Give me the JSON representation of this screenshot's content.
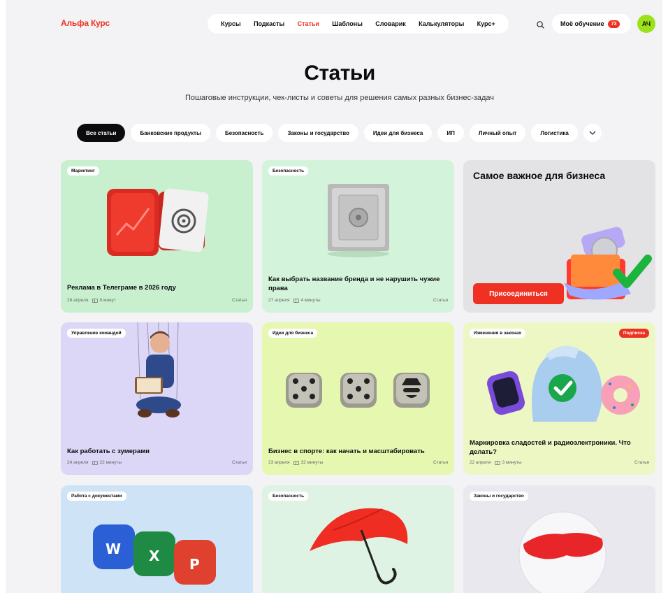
{
  "header": {
    "logo": "Альфа Курс",
    "nav": [
      "Курсы",
      "Подкасты",
      "Статьи",
      "Шаблоны",
      "Словарик",
      "Калькуляторы",
      "Курс+"
    ],
    "active_nav": "Статьи",
    "search_icon": "search-icon",
    "learning_label": "Моё обучение",
    "learning_count": "73",
    "avatar_initials": "АЧ"
  },
  "hero": {
    "title": "Статьи",
    "subtitle": "Пошаговые инструкции, чек-листы и советы для решения самых разных бизнес-задач"
  },
  "filters": {
    "items": [
      "Все статьи",
      "Банковские продукты",
      "Безопасность",
      "Законы и государство",
      "Идеи для бизнеса",
      "ИП",
      "Личный опыт",
      "Логистика"
    ],
    "active": "Все статьи",
    "more_icon": "chevron-down-icon"
  },
  "cards": [
    {
      "tag": "Маркетинг",
      "title": "Реклама в Телеграме в 2026 году",
      "date": "28 апреля",
      "duration": "8 минут",
      "type": "Статья",
      "bg": "#c8f0cf"
    },
    {
      "tag": "Безопасность",
      "title": "Как выбрать название бренда и не нарушить чужие права",
      "date": "27 апреля",
      "duration": "4 минуты",
      "type": "Статья",
      "bg": "#d3f3da"
    },
    {
      "title": "Самое важное для бизнеса",
      "button": "Присоединиться",
      "bg": "#e3e3e6"
    },
    {
      "tag": "Управление командой",
      "title": "Как работать с зумерами",
      "date": "24 апреля",
      "duration": "22 минуты",
      "type": "Статья",
      "bg": "#dcd6f7"
    },
    {
      "tag": "Идеи для бизнеса",
      "title": "Бизнес в спорте: как начать и масштабировать",
      "date": "23 апреля",
      "duration": "32 минуты",
      "type": "Статья",
      "bg": "#e6f7b0"
    },
    {
      "tag": "Изменения в законах",
      "badge": "Подписка",
      "title": "Маркировка сладостей и радиоэлектроники. Что делать?",
      "date": "22 апреля",
      "duration": "3 минуты",
      "type": "Статья",
      "bg": "#edf7c4"
    },
    {
      "tag": "Работа с документами",
      "bg": "#cfe3f7"
    },
    {
      "tag": "Безопасность",
      "bg": "#dff3e4"
    },
    {
      "tag": "Законы и государство",
      "bg": "#e9e8ee"
    }
  ]
}
